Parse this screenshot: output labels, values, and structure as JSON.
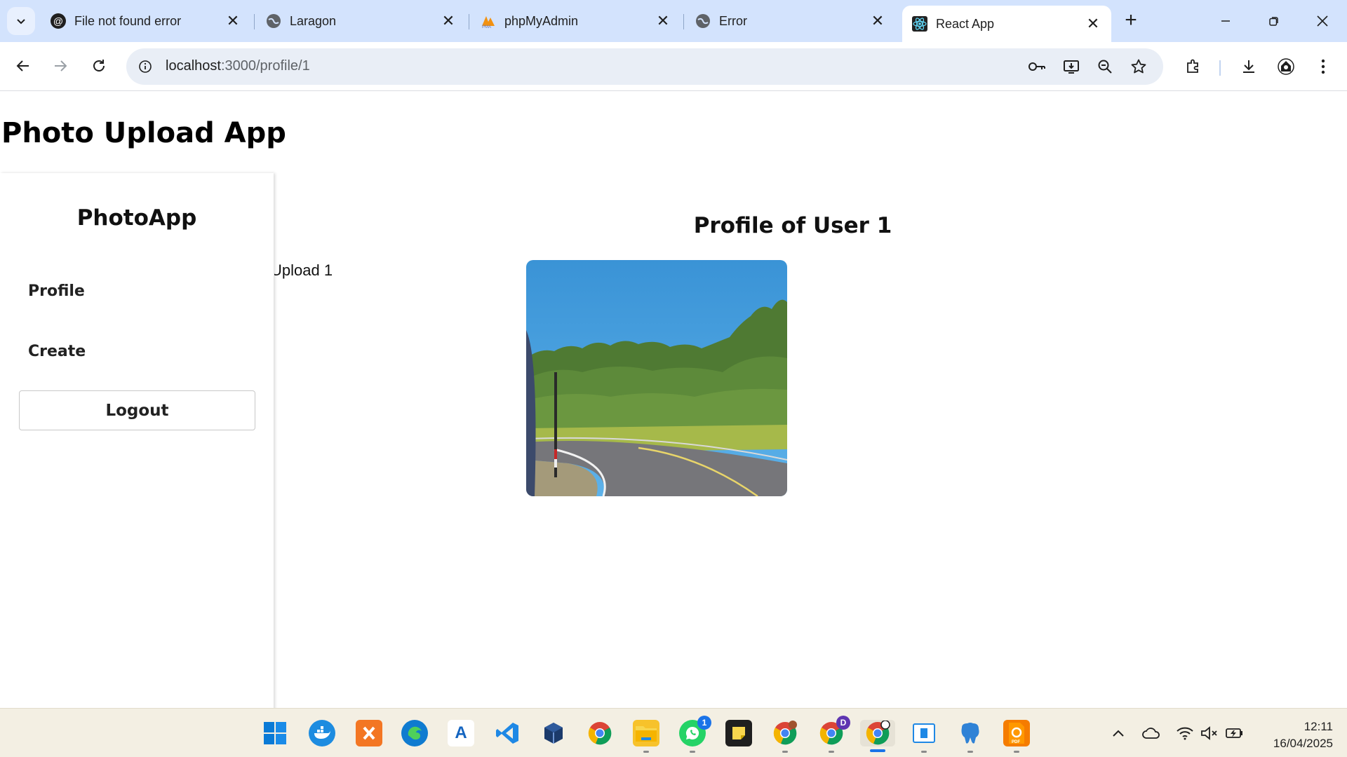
{
  "browser": {
    "tabs": [
      {
        "title": "File not found error",
        "favicon": "threads-icon",
        "active": false
      },
      {
        "title": "Laragon",
        "favicon": "globe-icon",
        "active": false
      },
      {
        "title": "phpMyAdmin",
        "favicon": "phpmyadmin-icon",
        "active": false
      },
      {
        "title": "Error",
        "favicon": "globe-icon",
        "active": false
      },
      {
        "title": "React App",
        "favicon": "react-icon",
        "active": true
      }
    ],
    "address": {
      "host": "localhost",
      "path": ":3000/profile/1"
    }
  },
  "page": {
    "app_title": "Photo Upload App",
    "sidebar": {
      "brand": "PhotoApp",
      "links": [
        "Profile",
        "Create"
      ],
      "logout_label": "Logout"
    },
    "main": {
      "heading": "Profile of User 1",
      "upload_label": "Upload 1",
      "photo_alt": "road photo"
    }
  },
  "taskbar": {
    "apps": [
      "windows-start-icon",
      "docker-icon",
      "xampp-icon",
      "edge-icon",
      "app-store-icon",
      "vscode-icon",
      "virtualbox-icon",
      "chrome-icon",
      "file-explorer-icon",
      "whatsapp-icon",
      "sticky-notes-icon",
      "chrome-profile-icon",
      "chrome-profile-d-icon",
      "chrome-active-icon",
      "app-window-icon",
      "pgadmin-icon",
      "pdf-icon"
    ],
    "whatsapp_badge": "1",
    "chrome_profile_badge": "D",
    "time": "12:11",
    "date": "16/04/2025"
  },
  "colors": {
    "tabstrip": "#d3e3fd",
    "omnibox": "#e9eef6",
    "taskbar": "#f3efe3",
    "accent": "#1a73e8"
  }
}
